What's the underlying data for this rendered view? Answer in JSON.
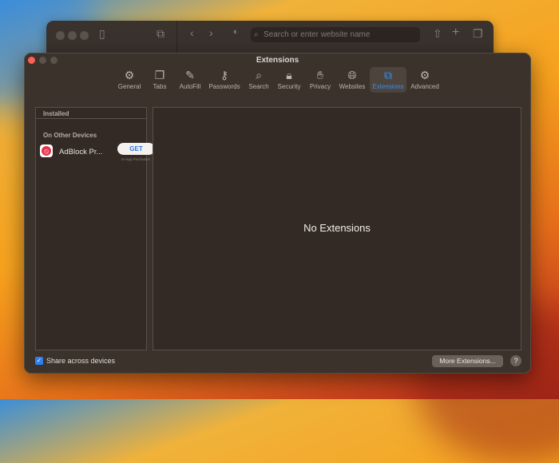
{
  "browser": {
    "search_placeholder": "Search or enter website name"
  },
  "prefs": {
    "title": "Extensions",
    "tabs": [
      {
        "label": "General",
        "icon": "⚙"
      },
      {
        "label": "Tabs",
        "icon": "❐"
      },
      {
        "label": "AutoFill",
        "icon": "✎"
      },
      {
        "label": "Passwords",
        "icon": "⚷"
      },
      {
        "label": "Search",
        "icon": "⌕"
      },
      {
        "label": "Security",
        "icon": "🔒︎"
      },
      {
        "label": "Privacy",
        "icon": "✋︎"
      },
      {
        "label": "Websites",
        "icon": "🌐︎"
      },
      {
        "label": "Extensions",
        "icon": "⧉"
      },
      {
        "label": "Advanced",
        "icon": "⚙"
      }
    ],
    "selected_tab": "Extensions",
    "accent": "#3a8fe8",
    "installed_header": "Installed",
    "other_devices_header": "On Other Devices",
    "extension": {
      "name": "AdBlock Pr...",
      "get_label": "GET",
      "note": "In-App Purchases"
    },
    "empty_message": "No Extensions",
    "share_label": "Share across devices",
    "share_checked": true,
    "more_button": "More Extensions...",
    "help_label": "?"
  }
}
